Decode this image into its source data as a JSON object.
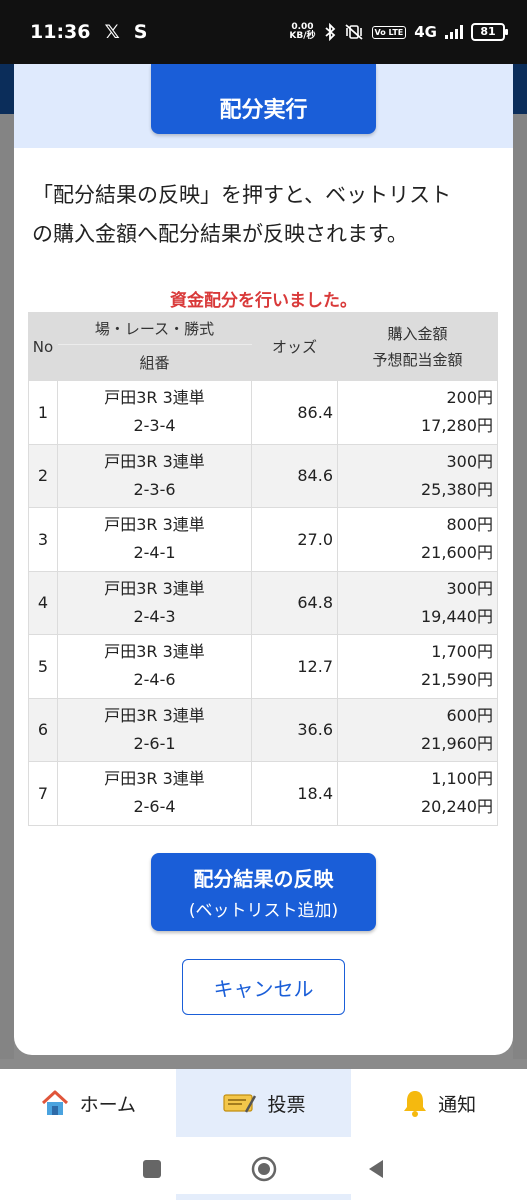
{
  "status_bar": {
    "time": "11:36",
    "x_label": "𝕏",
    "s_label": "S",
    "net_speed_top": "0.00",
    "net_speed_bottom": "KB/秒",
    "volte": "Vo LTE",
    "network": "4G",
    "battery": "81"
  },
  "modal": {
    "execute_button": "配分実行",
    "instruction_line1": "「配分結果の反映」を押すと、ベットリスト",
    "instruction_line2": "の購入金額へ配分結果が反映されます。",
    "result_message": "資金配分を行いました。",
    "table": {
      "header_no": "No",
      "header_venue": "場・レース・勝式",
      "header_combo": "組番",
      "header_odds": "オッズ",
      "header_amount_line1": "購入金額",
      "header_amount_line2": "予想配当金額",
      "rows": [
        {
          "no": "1",
          "bet": "戸田3R 3連単",
          "combo": "2-3-4",
          "odds": "86.4",
          "amount": "200円",
          "payout": "17,280円"
        },
        {
          "no": "2",
          "bet": "戸田3R 3連単",
          "combo": "2-3-6",
          "odds": "84.6",
          "amount": "300円",
          "payout": "25,380円"
        },
        {
          "no": "3",
          "bet": "戸田3R 3連単",
          "combo": "2-4-1",
          "odds": "27.0",
          "amount": "800円",
          "payout": "21,600円"
        },
        {
          "no": "4",
          "bet": "戸田3R 3連単",
          "combo": "2-4-3",
          "odds": "64.8",
          "amount": "300円",
          "payout": "19,440円"
        },
        {
          "no": "5",
          "bet": "戸田3R 3連単",
          "combo": "2-4-6",
          "odds": "12.7",
          "amount": "1,700円",
          "payout": "21,590円"
        },
        {
          "no": "6",
          "bet": "戸田3R 3連単",
          "combo": "2-6-1",
          "odds": "36.6",
          "amount": "600円",
          "payout": "21,960円"
        },
        {
          "no": "7",
          "bet": "戸田3R 3連単",
          "combo": "2-6-4",
          "odds": "18.4",
          "amount": "1,100円",
          "payout": "20,240円"
        }
      ]
    },
    "reflect_button_line1": "配分結果の反映",
    "reflect_button_line2": "(ベットリスト追加)",
    "cancel_button": "キャンセル"
  },
  "bottom_nav": {
    "items": [
      {
        "label": "ホーム",
        "icon": "home-icon"
      },
      {
        "label": "投票",
        "icon": "ticket-icon",
        "active": true
      },
      {
        "label": "通知",
        "icon": "bell-icon"
      }
    ]
  },
  "colors": {
    "primary": "#1a5ed8",
    "alert": "#d93a3a",
    "header_bg": "#0b2d5a"
  }
}
